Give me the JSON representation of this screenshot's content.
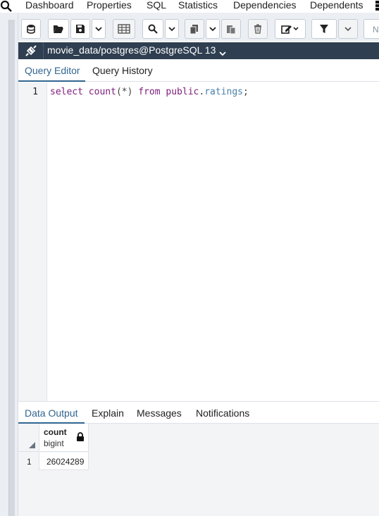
{
  "top_tabs": [
    "Dashboard",
    "Properties",
    "SQL",
    "Statistics",
    "Dependencies",
    "Dependents"
  ],
  "toolbar": {
    "buttons": [
      "database-icon",
      "folder-open-icon",
      "save-icon",
      "chevron-down-icon",
      "table-icon",
      "search-icon",
      "chevron-down-icon",
      "copy-icon",
      "chevron-down-icon",
      "paste-icon",
      "trash-icon",
      "edit-icon",
      "filter-icon",
      "chevron-down-icon"
    ],
    "rows_limit_placeholder": "No limit"
  },
  "connection": {
    "label": "movie_data/postgres@PostgreSQL 13"
  },
  "editor_tabs": [
    "Query Editor",
    "Query History"
  ],
  "editor": {
    "line_numbers": [
      "1"
    ],
    "query": {
      "kw_select": "select",
      "fn_count": "count",
      "paren": "(*)",
      "kw_from": "from",
      "schema": "public",
      "dot": ".",
      "table": "ratings",
      "semicolon": ";"
    }
  },
  "output_tabs": [
    "Data Output",
    "Explain",
    "Messages",
    "Notifications"
  ],
  "result": {
    "column_name": "count",
    "column_type": "bigint",
    "row_number": "1",
    "value": "26024289"
  },
  "colors": {
    "accent": "#326690",
    "connection_bar": "#2f3f51",
    "keyword": "#7d1c7a"
  }
}
